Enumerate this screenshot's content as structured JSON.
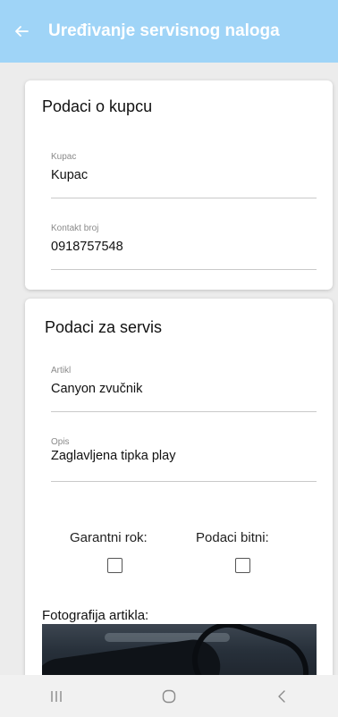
{
  "appbar": {
    "title": "Uređivanje servisnog naloga",
    "back_icon": "arrow-left-icon",
    "color": "#9fd4f7"
  },
  "customer_card": {
    "title": "Podaci o kupcu",
    "customer": {
      "label": "Kupac",
      "value": "Kupac"
    },
    "contact": {
      "label": "Kontakt broj",
      "value": "0918757548"
    }
  },
  "service_card": {
    "title": "Podaci za servis",
    "item": {
      "label": "Artikl",
      "value": "Canyon zvučnik"
    },
    "description": {
      "label": "Opis",
      "value": "Zaglavljena tipka play"
    },
    "warranty_label": "Garantni rok:",
    "data_important_label": "Podaci bitni:",
    "warranty_checked": false,
    "data_important_checked": false,
    "photo_label": "Fotografija artikla:"
  },
  "navbar": {
    "icons": [
      "recent-apps-icon",
      "home-icon",
      "back-chevron-icon"
    ]
  }
}
